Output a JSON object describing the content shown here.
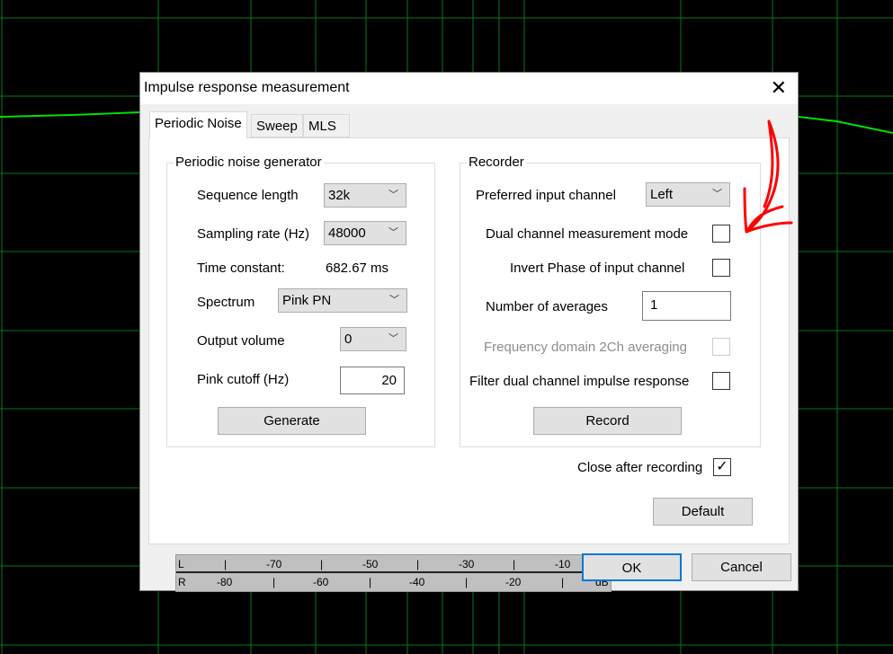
{
  "dialog": {
    "title": "Impulse response measurement",
    "close_icon": "close-icon"
  },
  "tabs": [
    {
      "label": "Periodic Noise",
      "active": true
    },
    {
      "label": "Sweep"
    },
    {
      "label": "MLS"
    }
  ],
  "generator": {
    "title": "Periodic noise generator",
    "sequence_length_label": "Sequence length",
    "sequence_length": "32k",
    "sampling_rate_label": "Sampling rate (Hz)",
    "sampling_rate": "48000",
    "time_constant_label": "Time constant:",
    "time_constant": "682.67 ms",
    "spectrum_label": "Spectrum",
    "spectrum": "Pink PN",
    "output_volume_label": "Output volume",
    "output_volume": "0",
    "pink_cutoff_label": "Pink cutoff (Hz)",
    "pink_cutoff": "20",
    "generate_label": "Generate"
  },
  "recorder": {
    "title": "Recorder",
    "preferred_input_label": "Preferred input channel",
    "preferred_input": "Left",
    "dual_channel_label": "Dual channel measurement mode",
    "dual_channel": false,
    "invert_phase_label": "Invert Phase of input channel",
    "invert_phase": false,
    "averages_label": "Number of averages",
    "averages": "1",
    "freq_avg_label": "Frequency domain 2Ch averaging",
    "freq_avg": false,
    "filter_label": "Filter dual channel impulse response",
    "filter": false,
    "record_label": "Record"
  },
  "close_after": {
    "label": "Close after recording",
    "checked": true
  },
  "meter": {
    "L": {
      "label": "L",
      "ticks": [
        "-70",
        "-50",
        "-30",
        "-10"
      ],
      "unit": "dB"
    },
    "R": {
      "label": "R",
      "ticks": [
        "-80",
        "-60",
        "-40",
        "-20"
      ],
      "unit": "dB"
    }
  },
  "buttons": {
    "default": "Default",
    "ok": "OK",
    "cancel": "Cancel"
  },
  "colors": {
    "grid": "#00a020",
    "curve": "#00e000",
    "accent": "#0078d7",
    "annotation": "#ff0000"
  }
}
